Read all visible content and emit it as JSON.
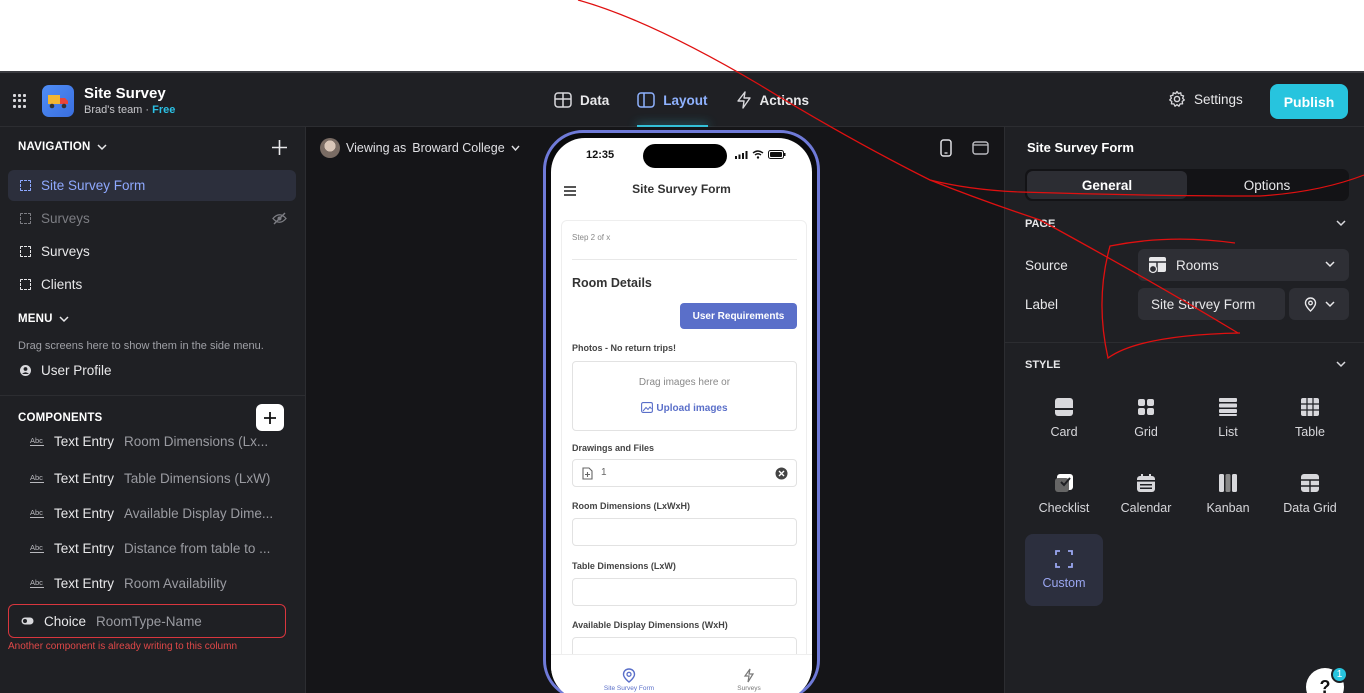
{
  "app": {
    "title": "Site Survey",
    "team": "Brad's team",
    "separator": " · ",
    "plan": "Free"
  },
  "topnav": {
    "data": "Data",
    "layout": "Layout",
    "actions": "Actions",
    "settings": "Settings",
    "publish": "Publish"
  },
  "navigation": {
    "header": "NAVIGATION",
    "items": [
      {
        "label": "Site Survey Form",
        "state": "active"
      },
      {
        "label": "Surveys",
        "state": "hidden"
      },
      {
        "label": "Surveys",
        "state": "normal"
      },
      {
        "label": "Clients",
        "state": "normal"
      }
    ]
  },
  "menu": {
    "header": "MENU",
    "hint": "Drag screens here to show them in the side menu.",
    "user_profile": "User Profile"
  },
  "components": {
    "header": "COMPONENTS",
    "items": [
      {
        "type": "Text Entry",
        "value": "Room Dimensions (Lx..."
      },
      {
        "type": "Text Entry",
        "value": "Table Dimensions (LxW)"
      },
      {
        "type": "Text Entry",
        "value": "Available Display Dime..."
      },
      {
        "type": "Text Entry",
        "value": "Distance from table to ..."
      },
      {
        "type": "Text Entry",
        "value": "Room Availability"
      }
    ],
    "choice": {
      "type": "Choice",
      "value": "RoomType-Name"
    },
    "error": "Another component is already writing to this column"
  },
  "canvas": {
    "viewing_prefix": "Viewing as",
    "viewing_user": "Broward College"
  },
  "phone": {
    "time": "12:35",
    "header": "Site Survey Form",
    "step": "Step 2 of x",
    "section_title": "Room Details",
    "user_req_button": "User Requirements",
    "photos_label": "Photos - No return trips!",
    "drop_text": "Drag images here or",
    "upload_text": "Upload images",
    "drawings_label": "Drawings and Files",
    "file_count": "1",
    "room_dim_label": "Room Dimensions (LxWxH)",
    "table_dim_label": "Table Dimensions (LxW)",
    "display_dim_label": "Available Display Dimensions (WxH)",
    "tab1": "Site Survey Form",
    "tab2": "Surveys"
  },
  "right": {
    "title": "Site Survey Form",
    "seg_general": "General",
    "seg_options": "Options",
    "page_header": "PAGE",
    "source_label": "Source",
    "source_value": "Rooms",
    "label_label": "Label",
    "label_value": "Site Survey Form",
    "style_header": "STYLE",
    "styles": [
      "Card",
      "Grid",
      "List",
      "Table",
      "Checklist",
      "Calendar",
      "Kanban",
      "Data Grid",
      "Custom"
    ],
    "help": "?",
    "help_badge": "1"
  },
  "colors": {
    "accent": "#27c4de",
    "active_text": "#8fb2ff",
    "error": "#d9363e",
    "phone_button": "#5a6fc9",
    "annotation": "#e01010"
  }
}
